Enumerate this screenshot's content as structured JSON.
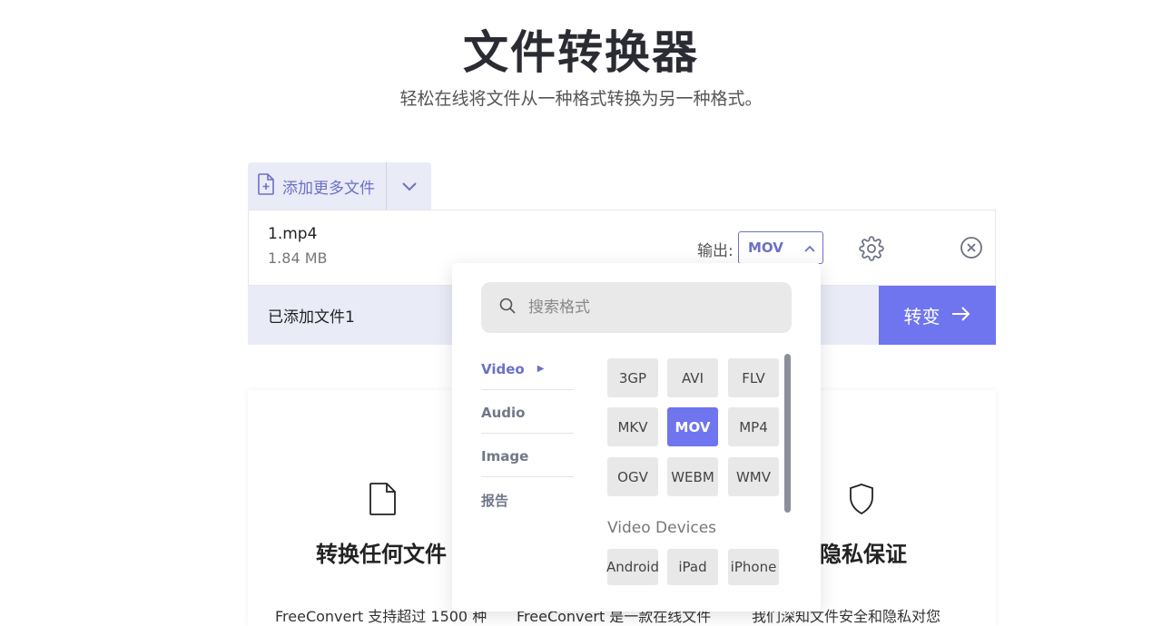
{
  "header": {
    "title": "文件转换器",
    "subtitle": "轻松在线将文件从一种格式转换为另一种格式。"
  },
  "upload": {
    "add_label": "添加更多文件"
  },
  "file": {
    "name": "1.mp4",
    "size": "1.84 MB",
    "output_label": "输出:",
    "output_value": "MOV"
  },
  "footer": {
    "added_text": "已添加文件1",
    "convert_label": "转变"
  },
  "features": {
    "left_title": "转换任何文件",
    "right_title": "隐私保证",
    "left_desc": "FreeConvert 支持超过 1500 种",
    "mid_desc": "FreeConvert 是一款在线文件",
    "right_desc": "我们深知文件安全和隐私对您"
  },
  "dropdown": {
    "search_placeholder": "搜索格式",
    "categories": [
      "Video",
      "Audio",
      "Image",
      "报告"
    ],
    "active_category": "Video",
    "formats": [
      "3GP",
      "AVI",
      "FLV",
      "MKV",
      "MOV",
      "MP4",
      "OGV",
      "WEBM",
      "WMV"
    ],
    "selected_format": "MOV",
    "devices_label": "Video Devices",
    "devices": [
      "Android",
      "iPad",
      "iPhone"
    ]
  },
  "colors": {
    "accent": "#6f74ef",
    "accent_text": "#6c71c4",
    "panel_bg": "#e9ebf7"
  }
}
